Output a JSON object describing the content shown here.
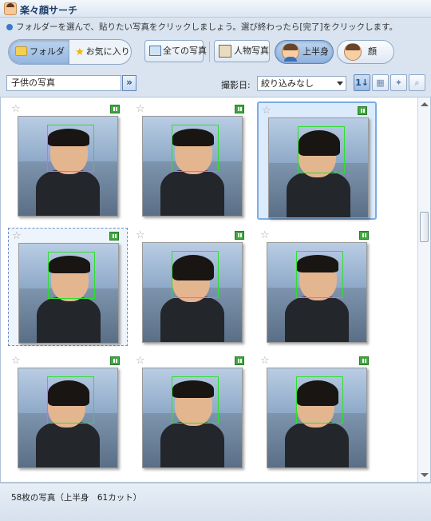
{
  "app": {
    "title": "楽々顔サーチ"
  },
  "instruction": "フォルダーを選んで、貼りたい写真をクリックしましょう。選び終わったら[完了]をクリックします。",
  "toolbar": {
    "folder_tab": "フォルダー",
    "favorites_tab": "お気に入り",
    "all_photos": "全ての写真",
    "person_photos": "人物写真",
    "upper_body": "上半身",
    "face": "顔",
    "selected_mode": "上半身",
    "icons": [
      "folder-icon",
      "star-icon",
      "picture-icon",
      "person-photo-icon",
      "upper-body-icon",
      "face-icon"
    ]
  },
  "filter": {
    "folder_name": "子供の写真",
    "go_symbol": "»",
    "date_label": "撮影日:",
    "date_value": "絞り込みなし"
  },
  "view_buttons": [
    {
      "name": "sort-order-button",
      "glyph": "1↓",
      "active": true
    },
    {
      "name": "group-button",
      "glyph": "▦",
      "active": false
    },
    {
      "name": "effect-button",
      "glyph": "✦",
      "active": false
    },
    {
      "name": "zoom-button",
      "glyph": "⌕",
      "active": false
    }
  ],
  "grid": {
    "items": [
      {
        "state": "normal",
        "face": "boy"
      },
      {
        "state": "normal",
        "face": "boy"
      },
      {
        "state": "selected",
        "face": "girl"
      },
      {
        "state": "focused",
        "face": "boy"
      },
      {
        "state": "normal",
        "face": "girl"
      },
      {
        "state": "normal",
        "face": "boy"
      },
      {
        "state": "normal",
        "face": "girl"
      },
      {
        "state": "normal",
        "face": "boy"
      },
      {
        "state": "normal",
        "face": "girl"
      }
    ]
  },
  "status": {
    "text": "58枚の写真（上半身　61カット）"
  },
  "colors": {
    "accent": "#7cace5",
    "face_box": "#2ee02e",
    "badge": "#3fa83f"
  }
}
